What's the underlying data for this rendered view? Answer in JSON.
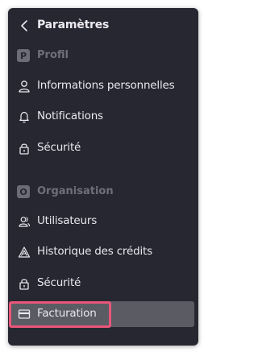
{
  "header": {
    "title": "Paramètres",
    "back_icon": "chevron-left-icon"
  },
  "sections": {
    "profil": {
      "badge": "P",
      "label": "Profil",
      "items": [
        {
          "label": "Informations personnelles",
          "icon": "user-icon"
        },
        {
          "label": "Notifications",
          "icon": "bell-icon"
        },
        {
          "label": "Sécurité",
          "icon": "lock-icon"
        }
      ]
    },
    "organisation": {
      "badge": "O",
      "label": "Organisation",
      "items": [
        {
          "label": "Utilisateurs",
          "icon": "users-icon"
        },
        {
          "label": "Historique des crédits",
          "icon": "triangle-icon"
        },
        {
          "label": "Sécurité",
          "icon": "lock-icon"
        },
        {
          "label": "Facturation",
          "icon": "credit-card-icon",
          "active": true
        }
      ]
    }
  },
  "colors": {
    "panel_bg": "#272732",
    "active_bg": "#5b5b64",
    "highlight_border": "#e9567a",
    "text": "#e9e8ee",
    "section_text": "#6f6f7a"
  }
}
